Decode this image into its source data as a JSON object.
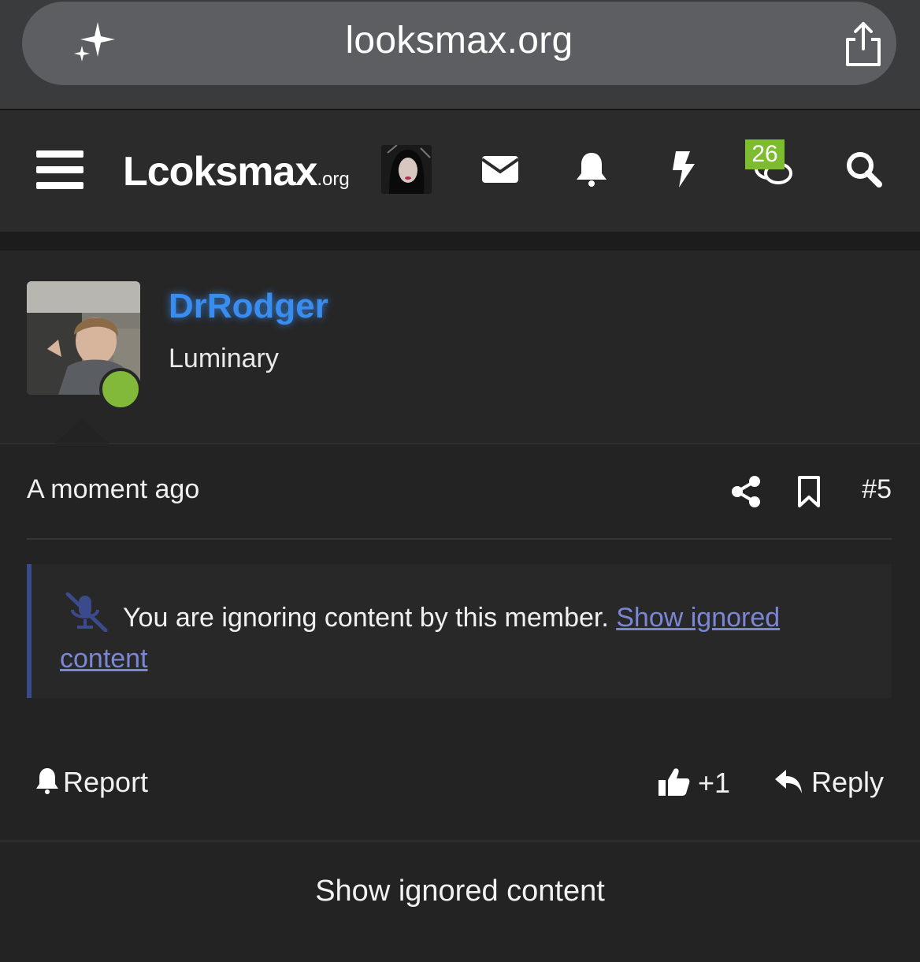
{
  "browser": {
    "url": "looksmax.org",
    "icons": [
      "sparkle-icon",
      "share-icon"
    ]
  },
  "header": {
    "logo_main": "Lcoksmax",
    "logo_tld": ".org",
    "icons": [
      "menu-icon",
      "envelope-icon",
      "bell-icon",
      "bolt-icon",
      "chat-icon",
      "search-icon"
    ],
    "chat_badge": "26",
    "accent": "#7dbb2f"
  },
  "post": {
    "username": "DrRodger",
    "user_title": "Luminary",
    "username_color": "#3a8df0",
    "online_color": "#82b93a",
    "time": "A moment ago",
    "post_number": "#5",
    "ignore_message": "You are ignoring content by this member.",
    "ignore_link": "Show ignored content",
    "actions": {
      "report": "Report",
      "like": "+1",
      "reply": "Reply"
    },
    "show_ignored": "Show ignored content"
  }
}
